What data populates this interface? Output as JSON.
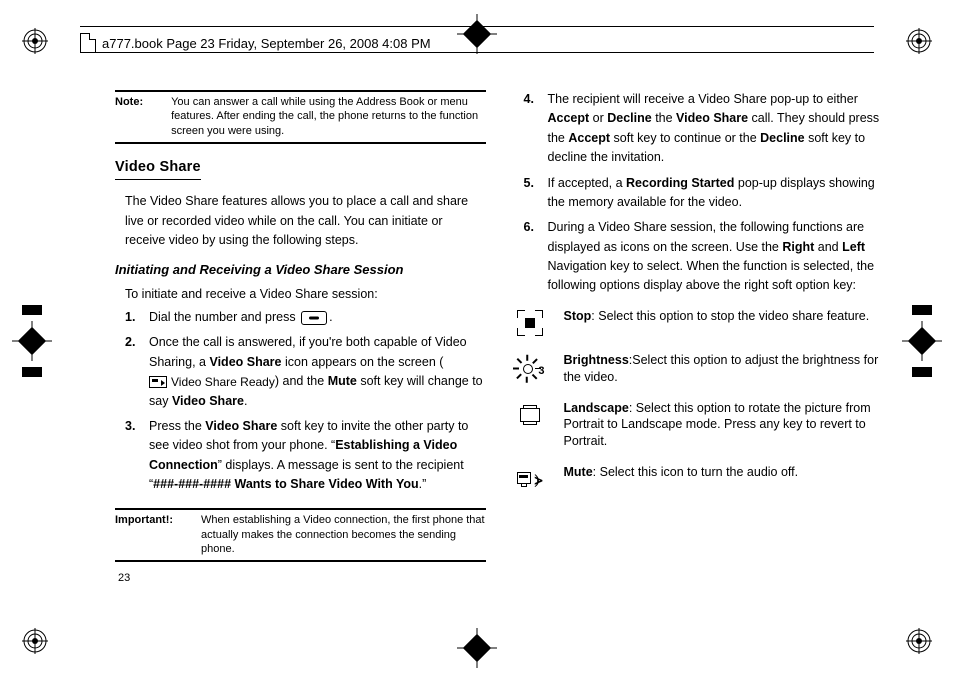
{
  "header": {
    "text": "a777.book  Page 23  Friday, September 26, 2008  4:08 PM"
  },
  "page_number": "23",
  "note": {
    "label": "Note:",
    "body": "You can answer a call while using the Address Book or menu features. After ending the call, the phone returns to the function screen you were using."
  },
  "section": {
    "title": "Video Share",
    "intro": "The Video Share features allows you to place a call and share live or recorded video while on the call. You can initiate or receive video by using the following steps.",
    "subsection_title": "Initiating and Receiving a Video Share Session",
    "lead": "To initiate and receive a Video Share session:"
  },
  "steps_left": {
    "s1": {
      "num": "1.",
      "txt_a": "Dial the number and press ",
      "txt_b": "."
    },
    "s2": {
      "num": "2.",
      "txt_a": "Once the call is answered, if you're both capable of Video Sharing, a ",
      "bold_a": "Video Share",
      "txt_b": " icon appears on the screen (",
      "ready": "Video Share Ready",
      "txt_c": ") and the ",
      "bold_b": "Mute",
      "txt_d": " soft key will change to say ",
      "bold_c": "Video Share",
      "txt_e": "."
    },
    "s3": {
      "num": "3.",
      "txt_a": "Press the ",
      "bold_a": "Video Share",
      "txt_b": " soft key to invite the other party to see video shot from your phone. “",
      "bold_b": "Establishing a Video Connection",
      "txt_c": "” displays. A message is sent to the recipient “",
      "bold_c": "###-###-#### Wants to Share Video With You",
      "txt_d": ".”"
    }
  },
  "important": {
    "label": "Important!:",
    "body": "When establishing a Video connection, the first phone that actually makes the connection becomes the sending phone."
  },
  "steps_right": {
    "s4": {
      "num": "4.",
      "txt_a": "The recipient will receive a Video Share pop-up to either ",
      "bold_a": "Accept",
      "txt_b": " or ",
      "bold_b": "Decline",
      "txt_c": " the ",
      "bold_c": "Video Share",
      "txt_d": " call. They should press the ",
      "bold_d": "Accept",
      "txt_e": " soft key to continue or the ",
      "bold_e": "Decline",
      "txt_f": " soft key to decline the invitation."
    },
    "s5": {
      "num": "5.",
      "txt_a": "If accepted, a ",
      "bold_a": "Recording Started",
      "txt_b": " pop-up displays showing the memory available for the video."
    },
    "s6": {
      "num": "6.",
      "txt_a": "During a Video Share session, the following functions are displayed as icons on the screen. Use the ",
      "bold_a": "Right",
      "txt_b": " and ",
      "bold_b": "Left",
      "txt_c": " Navigation key to select. When the function is selected, the following options display above the right soft option key:"
    }
  },
  "icons": {
    "stop": {
      "label": "Stop",
      "desc": ": Select this option to stop the video share feature."
    },
    "brightness": {
      "label": "Brightness",
      "desc": ":Select this option to adjust the brightness for the video.",
      "num": "3"
    },
    "landscape": {
      "label": "Landscape",
      "desc": ": Select this option to rotate the picture from Portrait to Landscape mode. Press any key to revert to Portrait."
    },
    "mute": {
      "label": "Mute",
      "desc": ": Select this icon to turn the audio off."
    }
  }
}
